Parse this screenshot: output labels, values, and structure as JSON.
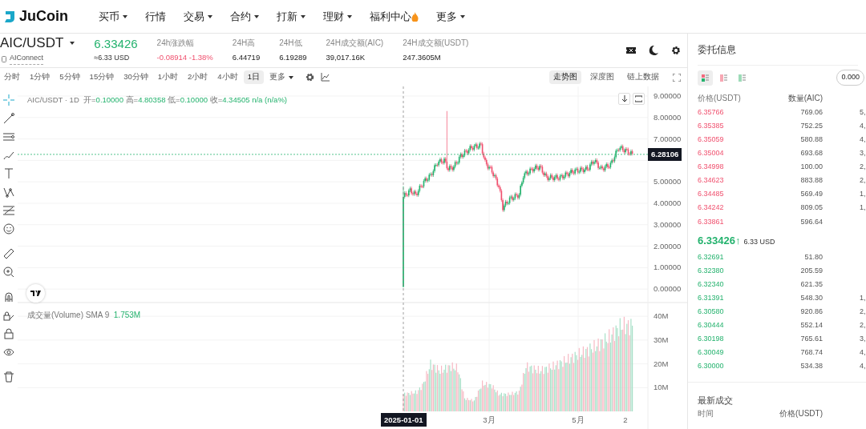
{
  "nav": {
    "logo": "JuCoin",
    "items": [
      {
        "label": "买币",
        "dropdown": true,
        "fire": false
      },
      {
        "label": "行情",
        "dropdown": false,
        "fire": false
      },
      {
        "label": "交易",
        "dropdown": true,
        "fire": false
      },
      {
        "label": "合约",
        "dropdown": true,
        "fire": false
      },
      {
        "label": "打新",
        "dropdown": true,
        "fire": false
      },
      {
        "label": "理财",
        "dropdown": true,
        "fire": false
      },
      {
        "label": "福利中心",
        "dropdown": false,
        "fire": true
      },
      {
        "label": "更多",
        "dropdown": true,
        "fire": false
      }
    ]
  },
  "ticker": {
    "pair": "AIC/USDT",
    "name": "AIConnect",
    "price": "6.33426",
    "price_usd": "≈6.33 USD",
    "stats": [
      {
        "label": "24h涨跌幅",
        "value": "-0.08914 -1.38%",
        "negative": true
      },
      {
        "label": "24H高",
        "value": "6.44719",
        "negative": false
      },
      {
        "label": "24H低",
        "value": "6.19289",
        "negative": false
      },
      {
        "label": "24H成交额(AIC)",
        "value": "39,017.16K",
        "negative": false
      },
      {
        "label": "24H成交额(USDT)",
        "value": "247.3605M",
        "negative": false
      }
    ]
  },
  "intervals": [
    {
      "label": "分时",
      "selected": false
    },
    {
      "label": "1分钟",
      "selected": false
    },
    {
      "label": "5分钟",
      "selected": false
    },
    {
      "label": "15分钟",
      "selected": false
    },
    {
      "label": "30分钟",
      "selected": false
    },
    {
      "label": "1小时",
      "selected": false
    },
    {
      "label": "2小时",
      "selected": false
    },
    {
      "label": "4小时",
      "selected": false
    },
    {
      "label": "1日",
      "selected": true
    }
  ],
  "more": "更多",
  "views": [
    {
      "label": "走势图",
      "selected": true
    },
    {
      "label": "深度图",
      "selected": false
    },
    {
      "label": "链上数据",
      "selected": false
    }
  ],
  "chart": {
    "legend_title": "AIC/USDT · 1D",
    "ohlc": [
      {
        "label": "开=",
        "value": "0.10000"
      },
      {
        "label": "高=",
        "value": "4.80358"
      },
      {
        "label": "低=",
        "value": "0.10000"
      },
      {
        "label": "收=",
        "value": "4.34505"
      }
    ],
    "change": "n/a (n/a%)",
    "price_ticks": [
      "9.00000",
      "8.00000",
      "7.00000",
      "5.00000",
      "4.00000",
      "3.00000",
      "2.00000",
      "1.00000",
      "0.00000"
    ],
    "last_price": "6.28106",
    "volume_legend": "成交量(Volume) SMA 9",
    "volume_value": "1.753M",
    "volume_ticks": [
      "40M",
      "30M",
      "20M",
      "10M"
    ],
    "dates": [
      "2025-01-01",
      "3月",
      "5月",
      "2"
    ]
  },
  "order_book": {
    "title": "委托信息",
    "precision": "0.000",
    "layouts": [
      {
        "kind": "both",
        "selected": true
      },
      {
        "kind": "asks",
        "selected": false
      },
      {
        "kind": "bids",
        "selected": false
      }
    ],
    "columns": [
      "价格(USDT)",
      "数量(AIC)"
    ],
    "asks": [
      {
        "price": "6.35766",
        "amount": "769.06",
        "total": "5,"
      },
      {
        "price": "6.35385",
        "amount": "752.25",
        "total": "4,"
      },
      {
        "price": "6.35059",
        "amount": "580.88",
        "total": "4,"
      },
      {
        "price": "6.35004",
        "amount": "693.68",
        "total": "3,"
      },
      {
        "price": "6.34998",
        "amount": "100.00",
        "total": "2,"
      },
      {
        "price": "6.34623",
        "amount": "883.88",
        "total": "2,"
      },
      {
        "price": "6.34485",
        "amount": "569.49",
        "total": "1,"
      },
      {
        "price": "6.34242",
        "amount": "809.05",
        "total": "1,"
      },
      {
        "price": "6.33861",
        "amount": "596.64"
      }
    ],
    "last": {
      "price": "6.33426",
      "arrow": "↑",
      "usd": "6.33 USD"
    },
    "bids": [
      {
        "price": "6.32691",
        "amount": "51.80"
      },
      {
        "price": "6.32380",
        "amount": "205.59"
      },
      {
        "price": "6.32340",
        "amount": "621.35"
      },
      {
        "price": "6.31391",
        "amount": "548.30",
        "total": "1,"
      },
      {
        "price": "6.30580",
        "amount": "920.86",
        "total": "2,"
      },
      {
        "price": "6.30444",
        "amount": "552.14",
        "total": "2,"
      },
      {
        "price": "6.30198",
        "amount": "765.61",
        "total": "3,"
      },
      {
        "price": "6.30049",
        "amount": "768.74",
        "total": "4,"
      },
      {
        "price": "6.30000",
        "amount": "534.38",
        "total": "4,"
      }
    ]
  },
  "trades": {
    "title": "最新成交",
    "columns": [
      "时间",
      "价格(USDT)"
    ]
  }
}
